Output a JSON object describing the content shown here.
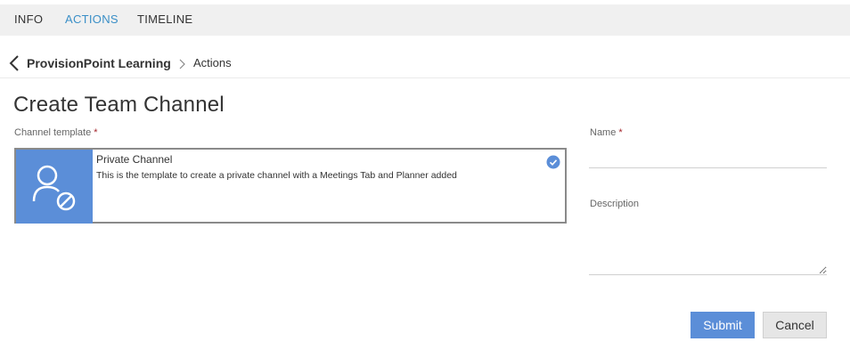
{
  "tabs": [
    {
      "label": "INFO",
      "active": false
    },
    {
      "label": "ACTIONS",
      "active": true
    },
    {
      "label": "TIMELINE",
      "active": false
    }
  ],
  "breadcrumb": {
    "root": "ProvisionPoint Learning",
    "current": "Actions",
    "back_icon": "chevron-left-icon",
    "separator_icon": "chevron-right-icon"
  },
  "page_title": "Create Team Channel",
  "form": {
    "channel_template_label": "Channel template",
    "required_mark": "*",
    "template": {
      "name": "Private Channel",
      "description": "This is the template to create a private channel with a Meetings Tab and Planner added",
      "icon": "private-user-icon",
      "selected": true,
      "selected_icon": "check-circle-icon"
    },
    "name_label": "Name",
    "name_value": "",
    "description_label": "Description",
    "description_value": ""
  },
  "buttons": {
    "submit": "Submit",
    "cancel": "Cancel"
  },
  "colors": {
    "accent": "#5b8ed8",
    "active_tab": "#3a8fc7",
    "required": "#a4262c"
  }
}
